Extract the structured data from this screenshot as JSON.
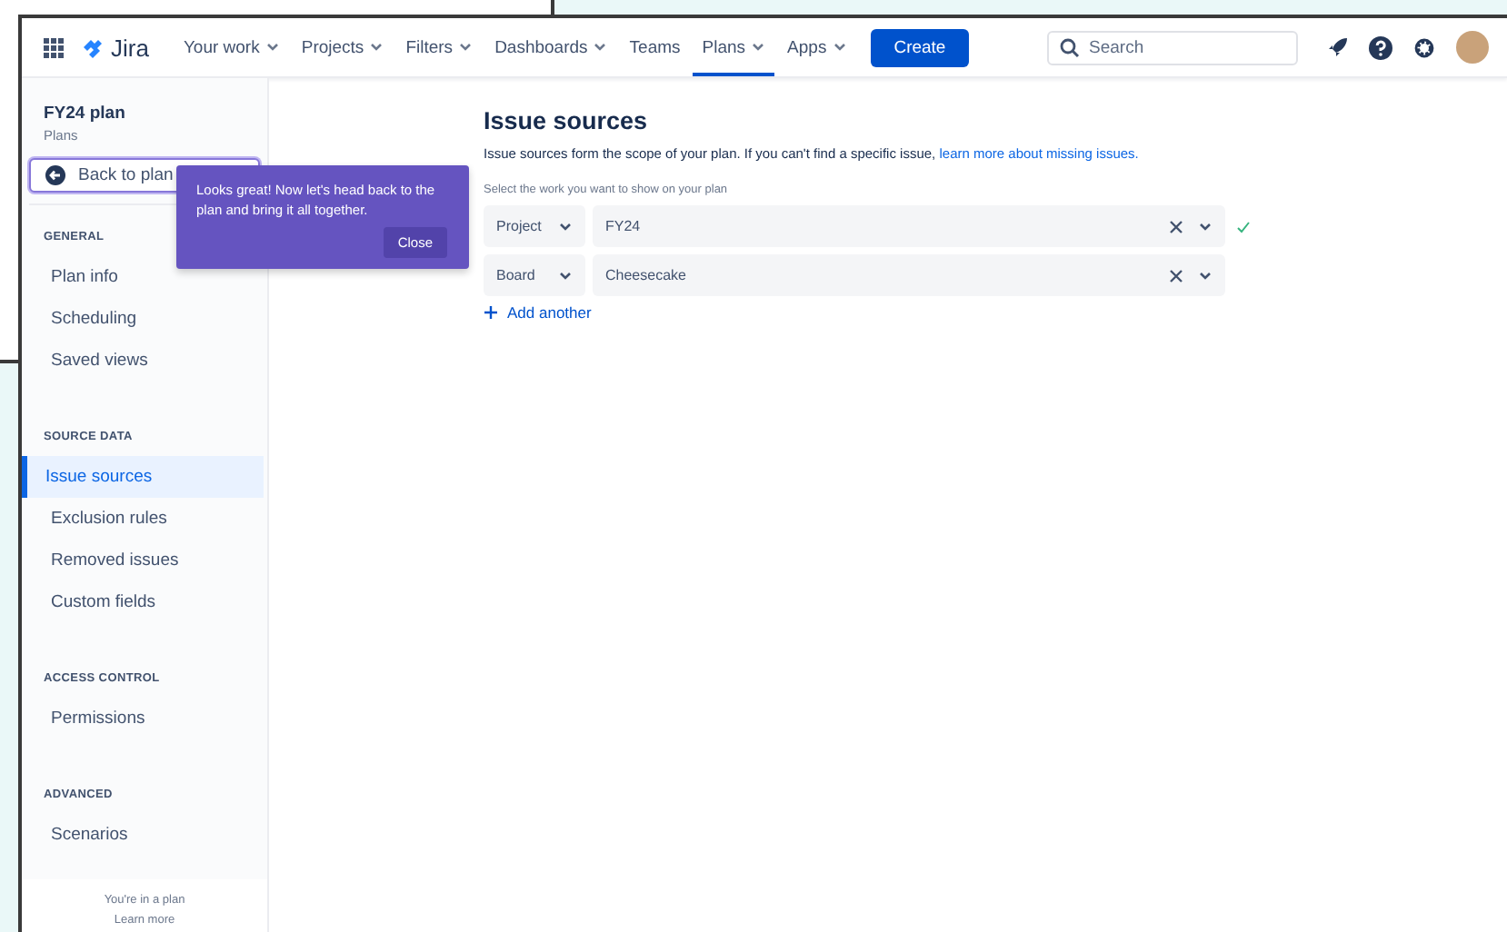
{
  "nav": {
    "product": "Jira",
    "items": [
      {
        "label": "Your work",
        "dropdown": true,
        "selected": false
      },
      {
        "label": "Projects",
        "dropdown": true,
        "selected": false
      },
      {
        "label": "Filters",
        "dropdown": true,
        "selected": false
      },
      {
        "label": "Dashboards",
        "dropdown": true,
        "selected": false
      },
      {
        "label": "Teams",
        "dropdown": false,
        "selected": false
      },
      {
        "label": "Plans",
        "dropdown": true,
        "selected": true
      },
      {
        "label": "Apps",
        "dropdown": true,
        "selected": false
      }
    ],
    "create": "Create",
    "search": {
      "placeholder": "Search"
    }
  },
  "sidebar": {
    "title": "FY24 plan",
    "subtitle": "Plans",
    "back": "Back to plan",
    "sections": [
      {
        "heading": "GENERAL",
        "items": [
          {
            "label": "Plan info",
            "selected": false
          },
          {
            "label": "Scheduling",
            "selected": false
          },
          {
            "label": "Saved views",
            "selected": false
          }
        ]
      },
      {
        "heading": "SOURCE DATA",
        "items": [
          {
            "label": "Issue sources",
            "selected": true
          },
          {
            "label": "Exclusion rules",
            "selected": false
          },
          {
            "label": "Removed issues",
            "selected": false
          },
          {
            "label": "Custom fields",
            "selected": false
          }
        ]
      },
      {
        "heading": "ACCESS CONTROL",
        "items": [
          {
            "label": "Permissions",
            "selected": false
          }
        ]
      },
      {
        "heading": "ADVANCED",
        "items": [
          {
            "label": "Scenarios",
            "selected": false
          }
        ]
      }
    ],
    "footer": "You're in a plan",
    "footer_link": "Learn more"
  },
  "tooltip": {
    "text": "Looks great! Now let's head back to the plan and bring it all together.",
    "button": "Close"
  },
  "main": {
    "title": "Issue sources",
    "description": "Issue sources form the scope of your plan. If you can't find a specific issue, ",
    "link": "learn more about missing issues.",
    "label": "Select the work you want to show on your plan",
    "sources": [
      {
        "type": "Project",
        "value": "FY24",
        "valid": true
      },
      {
        "type": "Board",
        "value": "Cheesecake",
        "valid": false
      }
    ],
    "add": "Add another"
  }
}
